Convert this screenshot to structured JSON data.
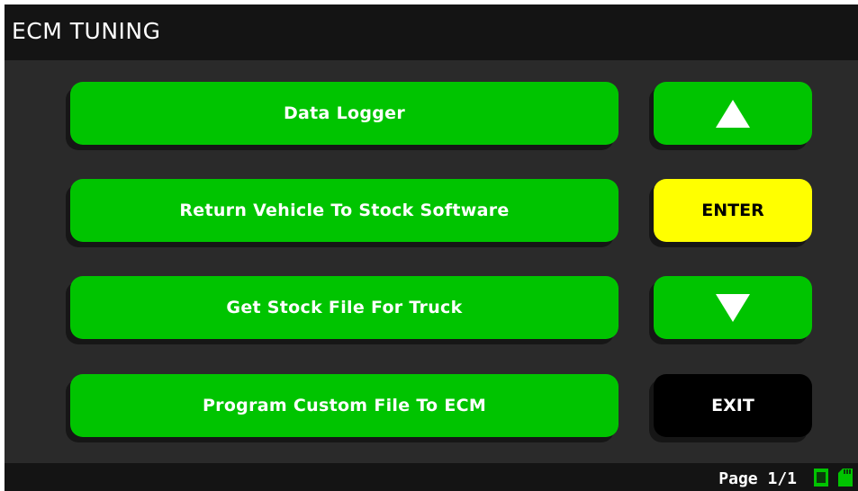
{
  "header": {
    "title": "ECM TUNING"
  },
  "menu": {
    "items": [
      {
        "label": "Data Logger"
      },
      {
        "label": "Return Vehicle To Stock Software"
      },
      {
        "label": "Get Stock File For Truck"
      },
      {
        "label": "Program Custom File To ECM"
      }
    ]
  },
  "controls": {
    "up_icon": "arrow-up-icon",
    "enter_label": "ENTER",
    "down_icon": "arrow-down-icon",
    "exit_label": "EXIT"
  },
  "status": {
    "page_label": "Page 1/1",
    "icons": [
      "memory-card-icon",
      "sd-card-icon"
    ]
  },
  "colors": {
    "button_green": "#00c400",
    "enter_yellow": "#ffff00",
    "exit_black": "#000000",
    "background": "#2a2a2a",
    "bar": "#141414"
  }
}
